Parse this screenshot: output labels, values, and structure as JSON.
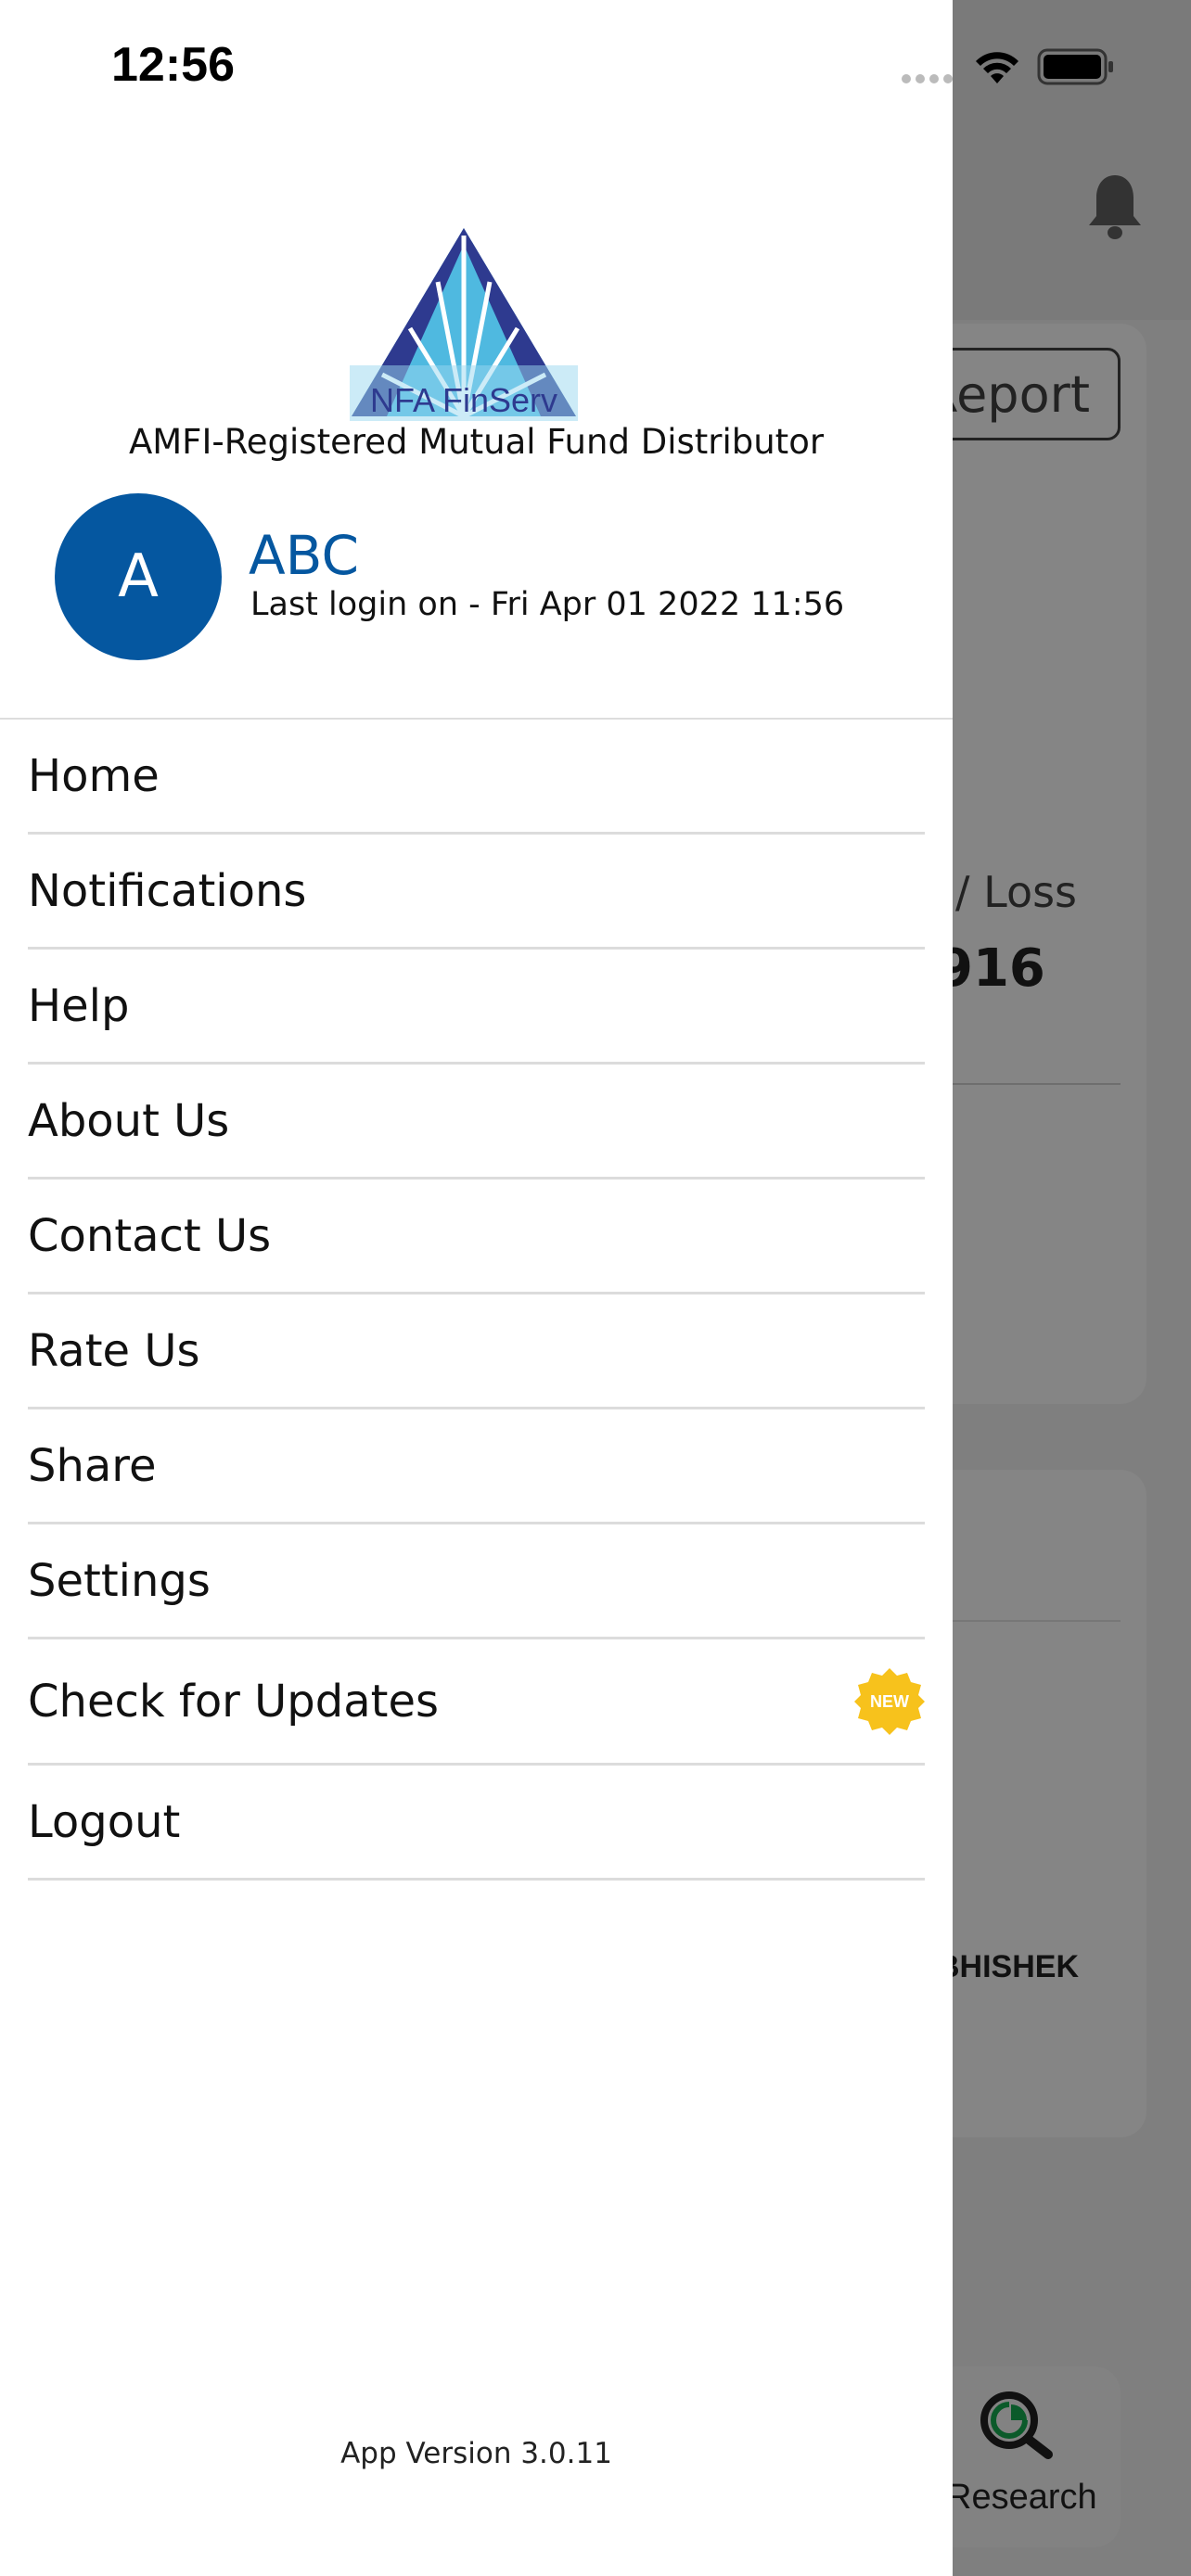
{
  "status_bar": {
    "time": "12:56"
  },
  "background": {
    "report_button": "Report",
    "profit_loss_label": "/ Loss",
    "profit_loss_value": "916",
    "name_fragment": "BHISHEK",
    "research_tab": "Research"
  },
  "drawer": {
    "logo_text": "NFA FinServ",
    "tagline": "AMFI-Registered Mutual Fund Distributor",
    "user": {
      "initial": "A",
      "name": "ABC",
      "last_login": "Last login on - Fri Apr 01 2022 11:56"
    },
    "menu": [
      {
        "label": "Home"
      },
      {
        "label": "Notifications"
      },
      {
        "label": "Help"
      },
      {
        "label": "About Us"
      },
      {
        "label": "Contact Us"
      },
      {
        "label": "Rate Us"
      },
      {
        "label": "Share"
      },
      {
        "label": "Settings"
      },
      {
        "label": "Check for Updates",
        "badge": "NEW"
      },
      {
        "label": "Logout"
      }
    ],
    "app_version": "App Version 3.0.11"
  },
  "colors": {
    "brand_blue": "#0557a0",
    "badge_yellow": "#f7c21c",
    "overlay": "#7f7f7f"
  }
}
